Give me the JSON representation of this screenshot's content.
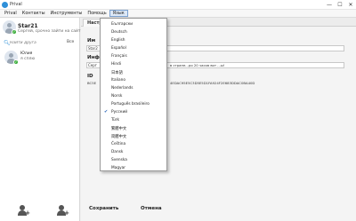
{
  "window": {
    "title": "Prival",
    "controls": [
      "—",
      "☐",
      "✕"
    ]
  },
  "menu": {
    "items": [
      "Prival",
      "Контакты",
      "Инструменты",
      "Помощь",
      "Язык"
    ]
  },
  "sidebar": {
    "me": {
      "name": "Star21",
      "status": "Сергей, срочно зайти на сайт вакансии скоро будет"
    },
    "search_placeholder": "Найти друга",
    "filter_label": "Все",
    "contacts": [
      {
        "name": "Юлия",
        "status": "я сплю"
      }
    ]
  },
  "settings": {
    "tab_label": "Настройки — Сохранение",
    "section1_label": "Им",
    "field1_value": "Star2",
    "section2_label": "Инф",
    "field2_value": "Серг",
    "field2_tail": "в стране...ро 20 часов вот ...ы!",
    "id_label": "ID",
    "id_value": "BC5E",
    "id_tail": "4EDAC95E5C3D5E5D1FA924F2E683DDAC0BA40D",
    "save_label": "Сохранить",
    "cancel_label": "Отмена"
  },
  "language_menu": {
    "items": [
      "Български",
      "Deutsch",
      "English",
      "Español",
      "Français",
      "Hindi",
      "日本語",
      "Italiano",
      "Nederlands",
      "Norsk",
      "Português brasileiro",
      "Русский",
      "Türk",
      "繁體中文",
      "简體中文",
      "Čeština",
      "Dansk",
      "Svenska",
      "Magyar"
    ],
    "selected": "Русский"
  }
}
